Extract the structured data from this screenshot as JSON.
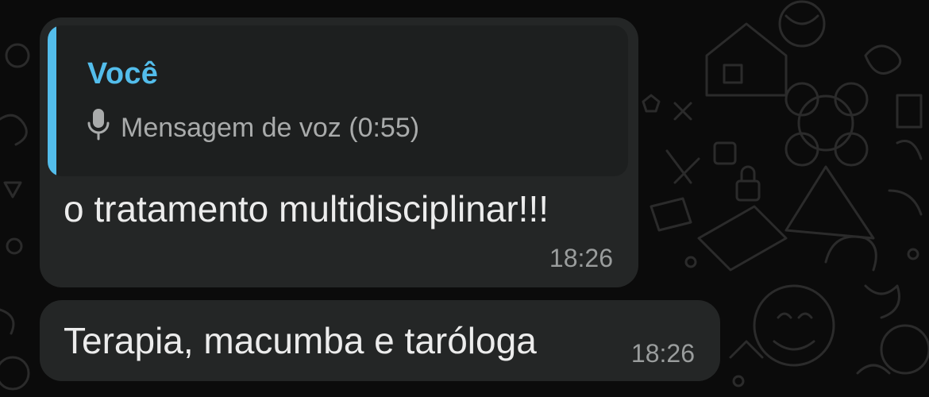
{
  "chat": {
    "messages": [
      {
        "reply": {
          "author": "Você",
          "icon": "microphone-icon",
          "text": "Mensagem de voz (0:55)"
        },
        "text": "o tratamento multidisciplinar!!!",
        "time": "18:26"
      },
      {
        "text": "Terapia, macumba e taróloga",
        "time": "18:26"
      }
    ]
  },
  "colors": {
    "background": "#0b0b0b",
    "bubble": "#242626",
    "quote_background": "#1d1f1f",
    "accent": "#53bdeb",
    "doodle": "#2a2a2a"
  }
}
